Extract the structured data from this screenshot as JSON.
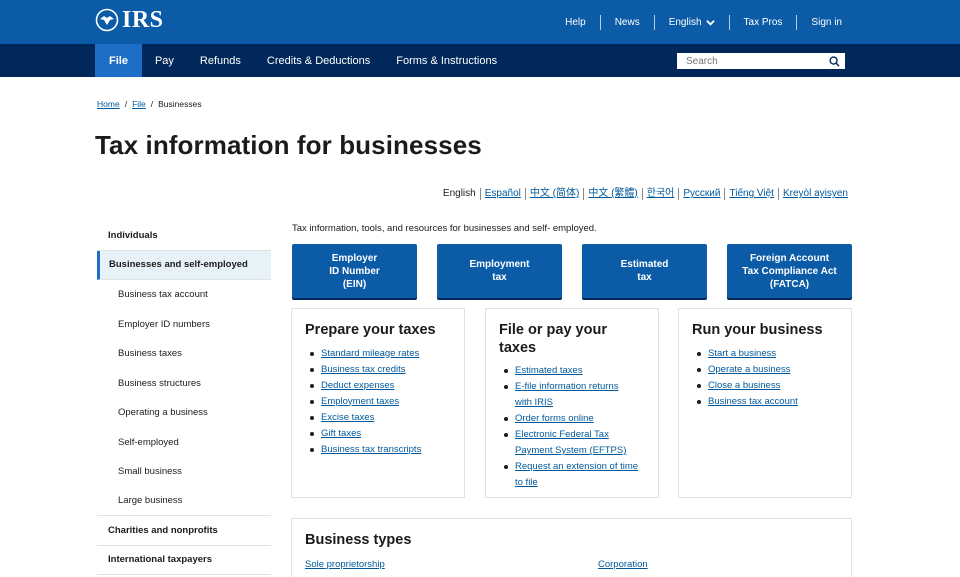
{
  "header": {
    "logo_text": "IRS",
    "utility": {
      "help": "Help",
      "news": "News",
      "language": "English",
      "tax_pros": "Tax Pros",
      "sign_in": "Sign in"
    }
  },
  "nav": {
    "items": [
      {
        "label": "File"
      },
      {
        "label": "Pay"
      },
      {
        "label": "Refunds"
      },
      {
        "label": "Credits & Deductions"
      },
      {
        "label": "Forms & Instructions"
      }
    ],
    "active": "File",
    "search_placeholder": "Search"
  },
  "breadcrumb": {
    "home": "Home",
    "file": "File",
    "current": "Businesses",
    "separator": "/"
  },
  "page_title": "Tax information for businesses",
  "languages": [
    "English",
    "Español",
    "中文 (简体)",
    "中文 (繁體)",
    "한국어",
    "Русский",
    "Tiếng Việt",
    "Kreyòl ayisyen"
  ],
  "sidebar": {
    "individuals": "Individuals",
    "businesses": "Businesses and self-employed",
    "sub": [
      "Business tax account",
      "Employer ID numbers",
      "Business taxes",
      "Business structures",
      "Operating a business",
      "Self-employed",
      "Small business",
      "Large business"
    ],
    "charities": "Charities and nonprofits",
    "international": "International taxpayers"
  },
  "intro": "Tax information, tools, and resources for businesses and self- employed.",
  "tiles": [
    {
      "line1": "Employer",
      "line2": "ID Number",
      "line3": "(EIN)"
    },
    {
      "line1": "Employment",
      "line2": "tax",
      "line3": ""
    },
    {
      "line1": "Estimated",
      "line2": "tax",
      "line3": ""
    },
    {
      "line1": "Foreign Account",
      "line2": "Tax Compliance Act",
      "line3": "(FATCA)"
    }
  ],
  "cards": {
    "prepare": {
      "title": "Prepare your taxes",
      "links": [
        "Standard mileage rates",
        "Business tax credits",
        "Deduct expenses",
        "Employment taxes",
        "Excise taxes",
        "Gift taxes",
        "Business tax transcripts"
      ]
    },
    "file_pay": {
      "title_line1": "File or pay your",
      "title_line2": "taxes",
      "links": [
        "Estimated taxes",
        "E-file information returns",
        "with IRIS",
        "Order forms online",
        "Electronic Federal Tax",
        "Payment System (EFTPS)",
        "Request an extension of time",
        "to file"
      ]
    },
    "run": {
      "title": "Run your business",
      "links": [
        "Start a business",
        "Operate a business",
        "Close a business",
        "Business tax account"
      ]
    }
  },
  "business_types": {
    "title": "Business types",
    "sole": "Sole proprietorship",
    "corp": "Corporation"
  },
  "colors": {
    "header_blue": "#0b5ba7",
    "nav_navy": "#00285b",
    "active_tab": "#1e6ec7",
    "link": "#00599c"
  }
}
